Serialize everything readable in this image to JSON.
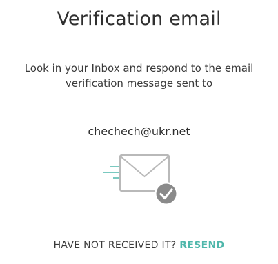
{
  "heading": {
    "title": "Verification email"
  },
  "message": {
    "text": "Look in your Inbox and respond to the email verification message sent to",
    "email": "chechech@ukr.net"
  },
  "illustration": {
    "icon": "envelope-with-checkmark-icon",
    "accent_color": "#4fb7ab",
    "check_badge_color": "#8a8a8a"
  },
  "footer": {
    "prompt": "HAVE NOT RECEIVED IT?",
    "resend_label": "RESEND",
    "resend_color": "#4fb7ab"
  }
}
